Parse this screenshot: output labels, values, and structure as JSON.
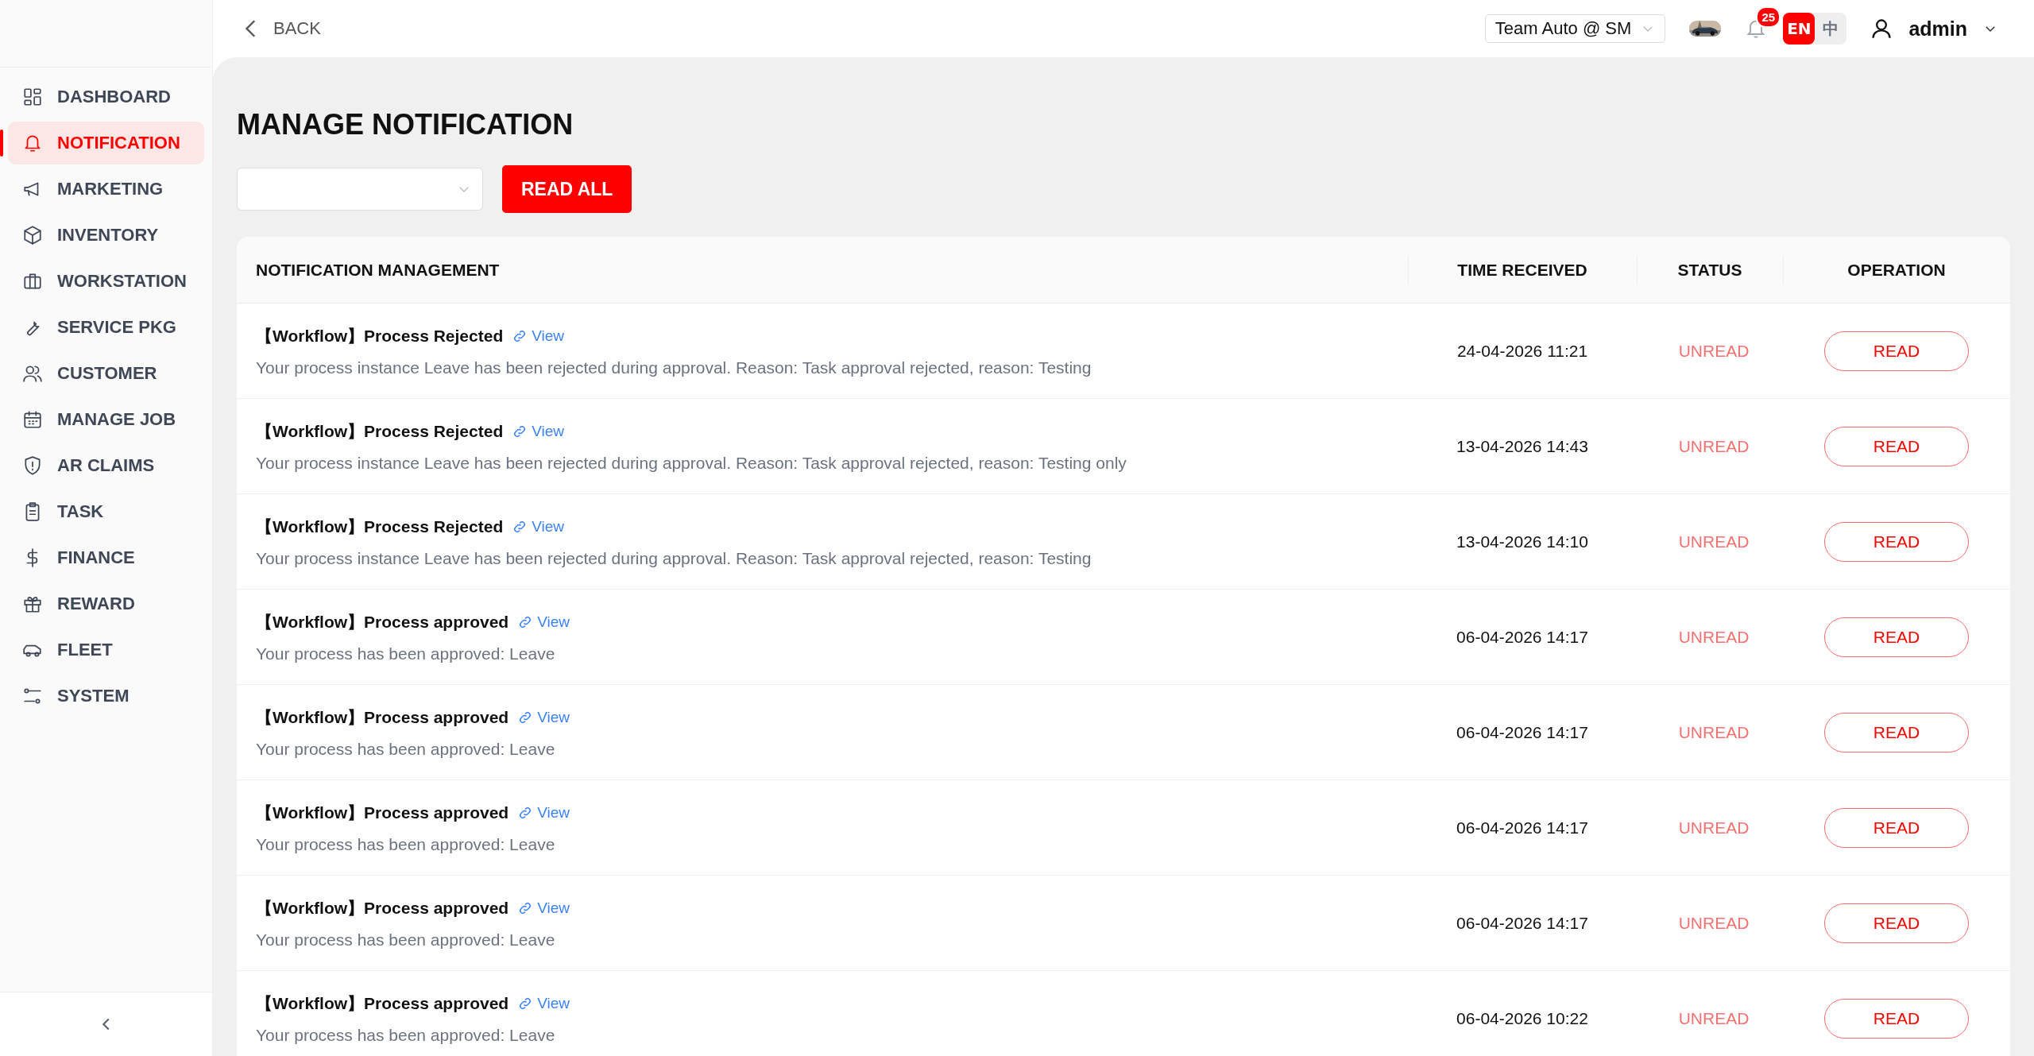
{
  "header": {
    "back": "BACK",
    "store": "Team Auto @ SM",
    "notification_count": "25",
    "languages": [
      {
        "label": "EN",
        "selected": true
      },
      {
        "label": "中",
        "selected": false
      }
    ],
    "user": "admin"
  },
  "sidebar": {
    "items": [
      {
        "label": "DASHBOARD",
        "selected": false
      },
      {
        "label": "NOTIFICATION",
        "selected": true
      },
      {
        "label": "MARKETING",
        "selected": false
      },
      {
        "label": "INVENTORY",
        "selected": false
      },
      {
        "label": "WORKSTATION",
        "selected": false
      },
      {
        "label": "SERVICE PKG",
        "selected": false
      },
      {
        "label": "CUSTOMER",
        "selected": false
      },
      {
        "label": "MANAGE JOB",
        "selected": false
      },
      {
        "label": "AR CLAIMS",
        "selected": false
      },
      {
        "label": "TASK",
        "selected": false
      },
      {
        "label": "FINANCE",
        "selected": false
      },
      {
        "label": "REWARD",
        "selected": false
      },
      {
        "label": "FLEET",
        "selected": false
      },
      {
        "label": "SYSTEM",
        "selected": false
      }
    ]
  },
  "page": {
    "title": "MANAGE NOTIFICATION",
    "read_all": "READ ALL"
  },
  "table": {
    "columns": [
      "NOTIFICATION MANAGEMENT",
      "TIME RECEIVED",
      "STATUS",
      "OPERATION"
    ],
    "rows": [
      {
        "title": "【Workflow】Process Rejected",
        "link": "View",
        "message": "Your process instance Leave has been rejected during approval. Reason: Task approval rejected, reason: Testing",
        "time": "24-04-2026 11:21",
        "status": "UNREAD",
        "action": "READ"
      },
      {
        "title": "【Workflow】Process Rejected",
        "link": "View",
        "message": "Your process instance Leave has been rejected during approval. Reason: Task approval rejected, reason: Testing only",
        "time": "13-04-2026 14:43",
        "status": "UNREAD",
        "action": "READ"
      },
      {
        "title": "【Workflow】Process Rejected",
        "link": "View",
        "message": "Your process instance Leave has been rejected during approval. Reason: Task approval rejected, reason: Testing",
        "time": "13-04-2026 14:10",
        "status": "UNREAD",
        "action": "READ"
      },
      {
        "title": "【Workflow】Process approved",
        "link": "View",
        "message": "Your process has been approved: Leave",
        "time": "06-04-2026 14:17",
        "status": "UNREAD",
        "action": "READ"
      },
      {
        "title": "【Workflow】Process approved",
        "link": "View",
        "message": "Your process has been approved: Leave",
        "time": "06-04-2026 14:17",
        "status": "UNREAD",
        "action": "READ"
      },
      {
        "title": "【Workflow】Process approved",
        "link": "View",
        "message": "Your process has been approved: Leave",
        "time": "06-04-2026 14:17",
        "status": "UNREAD",
        "action": "READ"
      },
      {
        "title": "【Workflow】Process approved",
        "link": "View",
        "message": "Your process has been approved: Leave",
        "time": "06-04-2026 14:17",
        "status": "UNREAD",
        "action": "READ"
      },
      {
        "title": "【Workflow】Process approved",
        "link": "View",
        "message": "Your process has been approved: Leave",
        "time": "06-04-2026 10:22",
        "status": "UNREAD",
        "action": "READ"
      }
    ]
  }
}
